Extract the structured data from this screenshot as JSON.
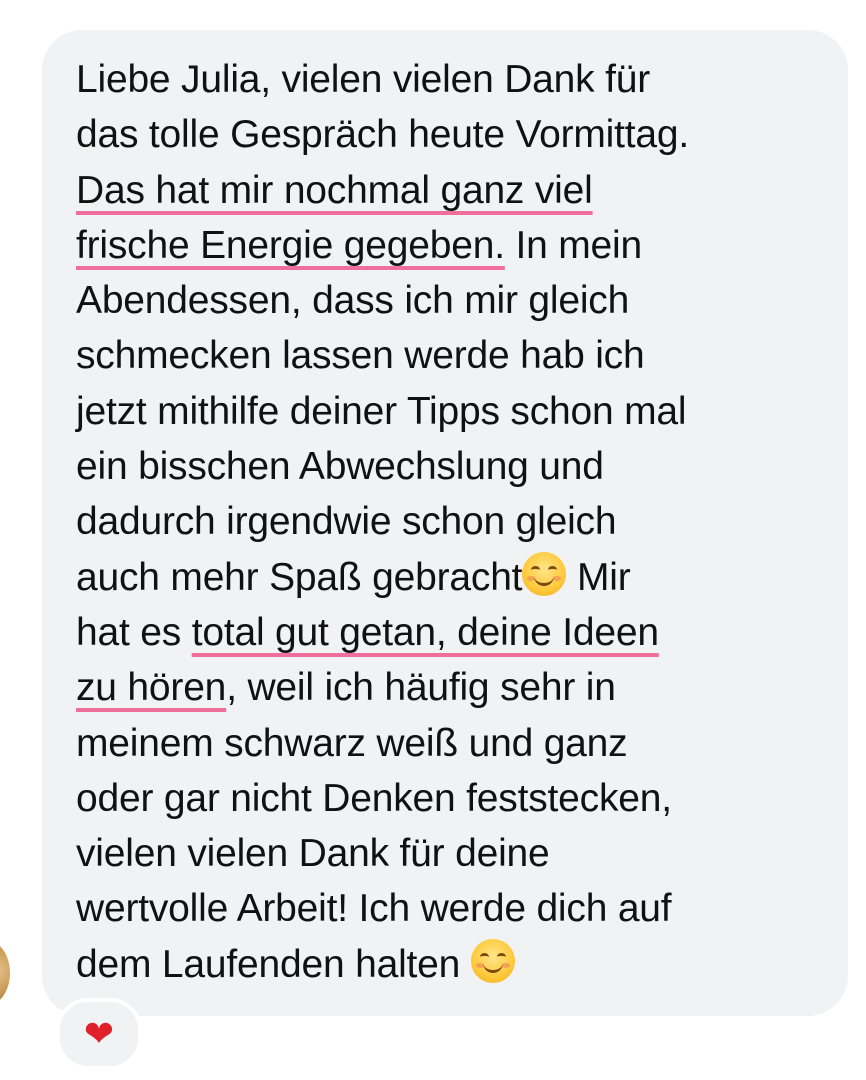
{
  "conversation": {
    "message": {
      "lines": [
        "Liebe Julia, vielen vielen Dank für",
        "das tolle Gespräch heute Vormittag.",
        "Das hat mir nochmal ganz viel",
        "frische Energie gegeben.",
        " In mein",
        "Abendessen, dass ich mir gleich",
        "schmecken lassen werde hab ich",
        "jetzt mithilfe deiner Tipps schon mal",
        "ein bisschen Abwechslung und",
        "dadurch irgendwie schon gleich",
        "auch mehr Spaß gebracht",
        " Mir",
        "hat es ",
        "total gut getan, deine Ideen",
        "zu hören",
        ", weil ich häufig sehr in",
        "meinem schwarz weiß und ganz",
        "oder gar nicht Denken feststecken,",
        "vielen vielen Dank für deine",
        "wertvolle Arbeit! Ich werde dich auf",
        "dem Laufenden halten "
      ],
      "emoji_icon": "smiling-face-icon",
      "highlight_color": "#ef6f9a",
      "bubble_color": "#f1f2f4"
    },
    "reaction": {
      "icon": "heart-icon",
      "glyph": "❤",
      "color": "#e0202b"
    }
  }
}
